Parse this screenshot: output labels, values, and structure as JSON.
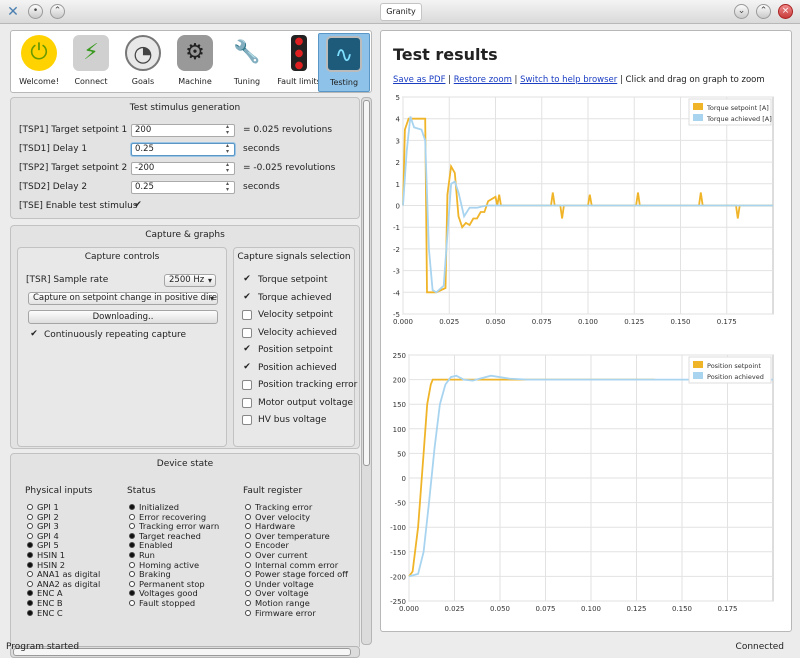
{
  "window": {
    "title": "Granity"
  },
  "tabs": [
    {
      "label": "Welcome!",
      "icon": "power-icon"
    },
    {
      "label": "Connect",
      "icon": "plug-icon"
    },
    {
      "label": "Goals",
      "icon": "gauge-icon"
    },
    {
      "label": "Machine",
      "icon": "motor-icon"
    },
    {
      "label": "Tuning",
      "icon": "wrench-icon"
    },
    {
      "label": "Fault limits",
      "icon": "traffic-light-icon"
    },
    {
      "label": "Testing",
      "icon": "oscilloscope-icon"
    }
  ],
  "stimulus": {
    "title": "Test stimulus generation",
    "rows": [
      {
        "label": "[TSP1] Target setpoint 1",
        "value": "200",
        "unit": "= 0.025 revolutions"
      },
      {
        "label": "[TSD1] Delay 1",
        "value": "0.25",
        "unit": "seconds"
      },
      {
        "label": "[TSP2] Target setpoint 2",
        "value": "-200",
        "unit": "= -0.025 revolutions"
      },
      {
        "label": "[TSD2] Delay 2",
        "value": "0.25",
        "unit": "seconds"
      }
    ],
    "enable_label": "[TSE] Enable test stimulus"
  },
  "capture": {
    "title": "Capture & graphs",
    "controls_title": "Capture controls",
    "sample_rate_label": "[TSR] Sample rate",
    "sample_rate_value": "2500 Hz",
    "trigger_value": "Capture on setpoint change in positive directio",
    "download_label": "Downloading..",
    "repeat_label": "Continuously repeating capture",
    "signals_title": "Capture signals selection",
    "signals": [
      {
        "label": "Torque setpoint",
        "checked": true
      },
      {
        "label": "Torque achieved",
        "checked": true
      },
      {
        "label": "Velocity setpoint",
        "checked": false
      },
      {
        "label": "Velocity achieved",
        "checked": false
      },
      {
        "label": "Position setpoint",
        "checked": true
      },
      {
        "label": "Position achieved",
        "checked": true
      },
      {
        "label": "Position tracking error",
        "checked": false
      },
      {
        "label": "Motor output voltage",
        "checked": false
      },
      {
        "label": "HV bus voltage",
        "checked": false
      }
    ]
  },
  "device": {
    "title": "Device state",
    "inputs_title": "Physical inputs",
    "inputs": [
      {
        "label": "GPI 1",
        "on": false
      },
      {
        "label": "GPI 2",
        "on": false
      },
      {
        "label": "GPI 3",
        "on": false
      },
      {
        "label": "GPI 4",
        "on": false
      },
      {
        "label": "GPI 5",
        "on": true
      },
      {
        "label": "HSIN 1",
        "on": true
      },
      {
        "label": "HSIN 2",
        "on": true
      },
      {
        "label": "ANA1 as digital",
        "on": false
      },
      {
        "label": "ANA2 as digital",
        "on": false
      },
      {
        "label": "ENC A",
        "on": true
      },
      {
        "label": "ENC B",
        "on": true
      },
      {
        "label": "ENC C",
        "on": true
      }
    ],
    "status_title": "Status",
    "status": [
      {
        "label": "Initialized",
        "on": true
      },
      {
        "label": "Error recovering",
        "on": false
      },
      {
        "label": "Tracking error warn",
        "on": false
      },
      {
        "label": "Target reached",
        "on": true
      },
      {
        "label": "Enabled",
        "on": true
      },
      {
        "label": "Run",
        "on": true
      },
      {
        "label": "Homing active",
        "on": false
      },
      {
        "label": "Braking",
        "on": false
      },
      {
        "label": "Permanent stop",
        "on": false
      },
      {
        "label": "Voltages good",
        "on": true
      },
      {
        "label": "Fault stopped",
        "on": false
      }
    ],
    "fault_title": "Fault register",
    "faults": [
      {
        "label": "Tracking error",
        "on": false
      },
      {
        "label": "Over velocity",
        "on": false
      },
      {
        "label": "Hardware",
        "on": false
      },
      {
        "label": "Over temperature",
        "on": false
      },
      {
        "label": "Encoder",
        "on": false
      },
      {
        "label": "Over current",
        "on": false
      },
      {
        "label": "Internal comm error",
        "on": false
      },
      {
        "label": "Power stage forced off",
        "on": false
      },
      {
        "label": "Under voltage",
        "on": false
      },
      {
        "label": "Over voltage",
        "on": false
      },
      {
        "label": "Motion range",
        "on": false
      },
      {
        "label": "Firmware error",
        "on": false
      }
    ]
  },
  "results": {
    "title": "Test results",
    "link_save": "Save as PDF",
    "link_zoom": "Restore zoom",
    "link_help": "Switch to help browser",
    "hint": "Click and drag on graph to zoom"
  },
  "colors": {
    "setpoint": "#f0b428",
    "achieved": "#a8d4f0"
  },
  "chart_data": [
    {
      "type": "line",
      "title": "",
      "xlim": [
        0,
        0.2
      ],
      "ylim": [
        -5,
        5
      ],
      "xticks": [
        0,
        0.025,
        0.05,
        0.075,
        0.1,
        0.125,
        0.15,
        0.175
      ],
      "yticks": [
        5,
        4,
        3,
        2,
        1,
        0,
        -1,
        -2,
        -3,
        -4,
        -5
      ],
      "legend": "top-right",
      "series": [
        {
          "name": "Torque setpoint [A]",
          "x": [
            0,
            0.001,
            0.003,
            0.005,
            0.007,
            0.008,
            0.012,
            0.013,
            0.018,
            0.023,
            0.024,
            0.026,
            0.028,
            0.03,
            0.032,
            0.034,
            0.036,
            0.038,
            0.04,
            0.042,
            0.044,
            0.046,
            0.05,
            0.051,
            0.052,
            0.053,
            0.055,
            0.08,
            0.081,
            0.082,
            0.085,
            0.086,
            0.087,
            0.1,
            0.101,
            0.102,
            0.126,
            0.127,
            0.128,
            0.16,
            0.161,
            0.162,
            0.18,
            0.181,
            0.182,
            0.2
          ],
          "y": [
            0,
            3.5,
            4,
            4,
            4,
            4,
            4,
            -4,
            -4,
            -3.8,
            0.5,
            1.8,
            1.5,
            -0.5,
            -1,
            -0.8,
            -0.9,
            -0.6,
            -0.6,
            -0.3,
            -0.3,
            0.2,
            0.4,
            0,
            0.5,
            0,
            0,
            0,
            0.6,
            0,
            0,
            -0.6,
            0,
            0,
            0.5,
            0,
            0,
            0.6,
            0,
            0,
            0.6,
            0,
            0,
            -0.6,
            0,
            0
          ]
        },
        {
          "name": "Torque achieved [A]",
          "x": [
            0,
            0.002,
            0.004,
            0.006,
            0.01,
            0.012,
            0.014,
            0.016,
            0.018,
            0.022,
            0.026,
            0.028,
            0.03,
            0.033,
            0.036,
            0.04,
            0.045,
            0.05,
            0.06,
            0.2
          ],
          "y": [
            0,
            2.5,
            4.1,
            3.6,
            3.5,
            3,
            -2,
            -3.9,
            -4,
            -3.7,
            1,
            1.1,
            0.6,
            -0.5,
            -0.1,
            -0.1,
            0,
            0,
            0,
            0
          ]
        }
      ]
    },
    {
      "type": "line",
      "title": "",
      "xlim": [
        0,
        0.2
      ],
      "ylim": [
        -250,
        250
      ],
      "xticks": [
        0,
        0.025,
        0.05,
        0.075,
        0.1,
        0.125,
        0.15,
        0.175
      ],
      "yticks": [
        250,
        200,
        150,
        100,
        50,
        0,
        -50,
        -100,
        -150,
        -200,
        -250
      ],
      "legend": "top-right",
      "series": [
        {
          "name": "Position setpoint",
          "x": [
            0,
            0.002,
            0.005,
            0.008,
            0.01,
            0.012,
            0.013,
            0.015,
            0.135
          ],
          "y": [
            -200,
            -190,
            -100,
            50,
            150,
            190,
            200,
            200,
            200
          ]
        },
        {
          "name": "Position achieved",
          "x": [
            0,
            0.005,
            0.008,
            0.011,
            0.014,
            0.017,
            0.02,
            0.023,
            0.026,
            0.03,
            0.035,
            0.045,
            0.055,
            0.065,
            0.2
          ],
          "y": [
            -200,
            -195,
            -150,
            -50,
            60,
            150,
            190,
            205,
            208,
            200,
            198,
            208,
            202,
            200,
            200
          ]
        }
      ]
    }
  ],
  "status": {
    "left": "Program started",
    "right": "Connected"
  }
}
